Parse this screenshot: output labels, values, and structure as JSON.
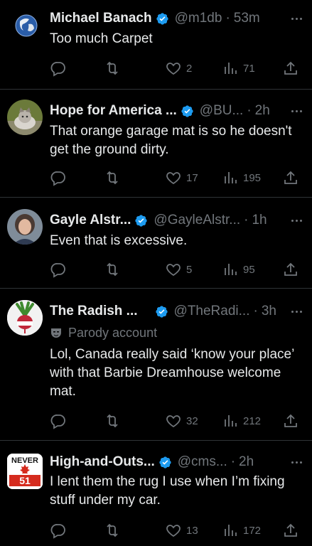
{
  "colors": {
    "background": "#000000",
    "text": "#e7e9ea",
    "muted": "#71767b",
    "verified": "#1d9bf0",
    "divider": "#2f3336"
  },
  "tweets": [
    {
      "name": "Michael Banach",
      "handle": "@m1db",
      "time": "53m",
      "text": "Too much Carpet",
      "replies": "",
      "retweets": "",
      "likes": "2",
      "views": "71",
      "avatar": "earth"
    },
    {
      "name": "Hope for America ...",
      "handle": "@BU...",
      "time": "2h",
      "text": "That orange garage mat is so he doesn't get the ground dirty.",
      "likes": "17",
      "views": "195",
      "avatar": "cat"
    },
    {
      "name": "Gayle Alstr...",
      "handle": "@GayleAlstr...",
      "time": "1h",
      "text": "Even that is excessive.",
      "likes": "5",
      "views": "95",
      "avatar": "person"
    },
    {
      "name": "The Radish ...",
      "handle": "@TheRadi...",
      "time": "3h",
      "label": "Parody account",
      "text": "Lol, Canada really said ‘know your place’ with that Barbie Dreamhouse welcome mat.",
      "likes": "32",
      "views": "212",
      "avatar": "radish"
    },
    {
      "name": "High-and-Outs...",
      "handle": "@cms...",
      "time": "2h",
      "text": "I lent them the rug I use when I’m fixing stuff under my car.",
      "likes": "13",
      "views": "172",
      "avatar": "never51",
      "avatar_text": {
        "top": "NEVER",
        "number": "51"
      }
    }
  ]
}
